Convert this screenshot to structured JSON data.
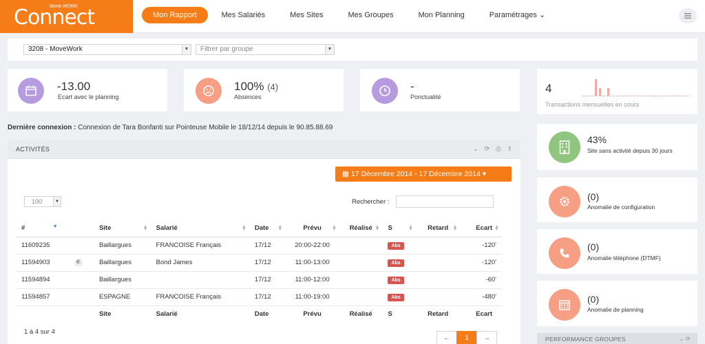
{
  "app": {
    "logo_tag": "Move WORK",
    "logo_text": "Connect"
  },
  "nav": [
    {
      "label": "Mon Rapport"
    },
    {
      "label": "Mes Salariés"
    },
    {
      "label": "Mes Sites"
    },
    {
      "label": "Mes Groupes"
    },
    {
      "label": "Mon Planning"
    },
    {
      "label": "Paramétrages ⌄"
    }
  ],
  "filters": {
    "company": "3208 - MoveWork",
    "group_placeholder": "Filtrer par groupe"
  },
  "stats": [
    {
      "value": "-13.00",
      "extra": "",
      "label": "Ecart avec le planning",
      "color": "#b79be0",
      "icon": "calendar-icon"
    },
    {
      "value": "100%",
      "extra": "(4)",
      "label": "Absences",
      "color": "#f79f84",
      "icon": "sad-face-icon"
    },
    {
      "value": "-",
      "extra": "",
      "label": "Ponctualité",
      "color": "#b79be0",
      "icon": "clock-icon"
    }
  ],
  "last_connection": {
    "label": "Dernière connexion :",
    "text": "Connexion de Tara Bonfanti sur Pointeuse Mobile le 18/12/14 depuis le 90.85.88.69"
  },
  "activities": {
    "title": "ACTIVITÉS",
    "date_range": "17 Décembre 2014 - 17 Décembre 2014 ▾",
    "page_size": "100",
    "search_label": "Rechercher :",
    "columns": [
      "#",
      "",
      "Site",
      "Salarié",
      "Date",
      "Prévu",
      "Réalisé",
      "S",
      "Retard",
      "Ecart"
    ],
    "rows": [
      {
        "id": "11609235",
        "phone": false,
        "site": "Baillargues",
        "employee": "FRANCOISE Français",
        "date": "17/12",
        "planned": "20:00-22:00",
        "done": "",
        "status": "Abs",
        "delay": "",
        "gap": "-120'"
      },
      {
        "id": "11594903",
        "phone": true,
        "site": "Baillargues",
        "employee": "Bond James",
        "date": "17/12",
        "planned": "11:00-13:00",
        "done": "",
        "status": "Abs",
        "delay": "",
        "gap": "-120'"
      },
      {
        "id": "11594894",
        "phone": false,
        "site": "Baillargues",
        "employee": "",
        "date": "17/12",
        "planned": "11:00-12:00",
        "done": "",
        "status": "Abs",
        "delay": "",
        "gap": "-60'"
      },
      {
        "id": "11594857",
        "phone": false,
        "site": "ESPAGNE",
        "employee": "FRANCOISE Français",
        "date": "17/12",
        "planned": "11:00-19:00",
        "done": "",
        "status": "Abs",
        "delay": "",
        "gap": "-480'"
      }
    ],
    "footer_columns": [
      "",
      "",
      "Site",
      "Salarié",
      "Date",
      "Prévu",
      "Réalisé",
      "S",
      "Retard",
      "Ecart"
    ],
    "info": "1 à 4 sur 4",
    "pager": {
      "prev": "←",
      "current": "1",
      "next": "→"
    }
  },
  "transactions": {
    "value": "4",
    "label": "Transactions mensuelles en cours",
    "bars": [
      1.0,
      0.45,
      0.0,
      0.45
    ]
  },
  "right_cards": [
    {
      "value": "43%",
      "label": "Site sans activité depuis 30 jours",
      "color": "#8fc57f",
      "icon": "building-icon"
    },
    {
      "value": "(0)",
      "label": "Anomalie de configuration",
      "color": "#f79f84",
      "icon": "gear-icon"
    },
    {
      "value": "(0)",
      "label": "Anomalie téléphone (DTMF)",
      "color": "#f79f84",
      "icon": "phone-icon"
    },
    {
      "value": "(0)",
      "label": "Anomalie de planning",
      "color": "#f79f84",
      "icon": "calendar-grid-icon"
    }
  ],
  "performance": {
    "title": "PERFORMANCE GROUPES"
  }
}
